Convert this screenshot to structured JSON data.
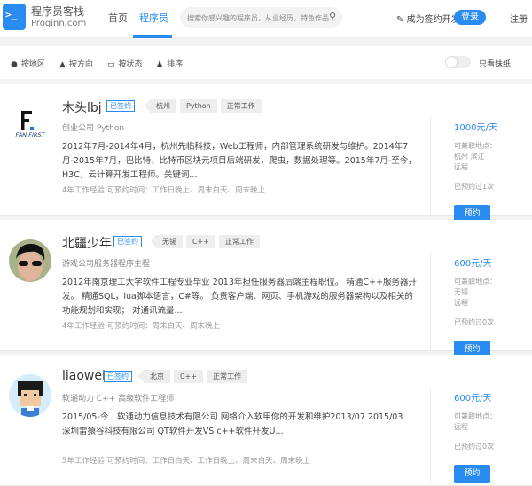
{
  "header": {
    "logo_glyph": ">_",
    "brand_cn": "程序员客栈",
    "brand_en": "Proginn.com",
    "nav": [
      "首页",
      "程序员"
    ],
    "search_placeholder": "搜索你感兴趣的程序员，从业经历，特色作品",
    "become": "成为签约开发者",
    "login": "登录",
    "register": "注册"
  },
  "filters": {
    "items": [
      "按地区",
      "按方向",
      "按状态",
      "排序"
    ],
    "toggle_label": "只看妹纸",
    "toggle_on": false
  },
  "cards": [
    {
      "name": "木头lbj",
      "badge": "已签约",
      "tags": [
        "杭州",
        "Python",
        "正常工作"
      ],
      "subtitle": "创业公司 Python",
      "desc": "2012年7月-2014年4月，杭州先临科技，Web工程师，内部管理系统研发与维护。2014年7月-2015年7月，巴比特，比特币区块元项目后端研发，爬虫，数据处理等。2015年7月-至今，H3C，云计算开发工程师。关键词...",
      "meta": "4年工作经验 可预约时间：工作日晚上、周末白天、周末晚上",
      "price": "1000元/天",
      "loc_label": "可兼职地点：",
      "locations": [
        "杭州 滨江",
        "远程"
      ],
      "booked": "已预约过1次",
      "book": "预约"
    },
    {
      "name": "北疆少年",
      "badge": "已签约",
      "tags": [
        "无锡",
        "C++",
        "正常工作"
      ],
      "subtitle": "游戏公司服务器程序主程",
      "desc": "2012年南京理工大学软件工程专业毕业 2013年担任服务器后端主程职位。 精通C++服务器开发。 精通SQL，lua脚本语言，C#等。 负责客户端、网页、手机游戏的服务器架构以及相关的功能规划和实现； 对通讯流量...",
      "meta": "4年工作经验 可预约时间：周末白天、周末晚上",
      "price": "600元/天",
      "loc_label": "可兼职地点：",
      "locations": [
        "无锡",
        "远程"
      ],
      "booked": "已预约过0次",
      "book": "预约"
    },
    {
      "name": "liaowei",
      "badge": "已签约",
      "tags": [
        "北京",
        "C++",
        "正常工作"
      ],
      "subtitle": "软通动力 C++ 高级软件工程师",
      "desc": "2015/05-今　软通动力信息技术有限公司 网络介入软甲你的开发和维护2013/07 2015/03　深圳雷猿谷科技有限公司 QT软件开发VS c++软件开发U...",
      "meta": "5年工作经验 可预约时间：工作日白天、工作日晚上、周末白天、周末晚上",
      "price": "600元/天",
      "loc_label": "可兼职地点：",
      "locations": [
        "远程"
      ],
      "booked": "已预约过0次",
      "book": "预约"
    }
  ]
}
